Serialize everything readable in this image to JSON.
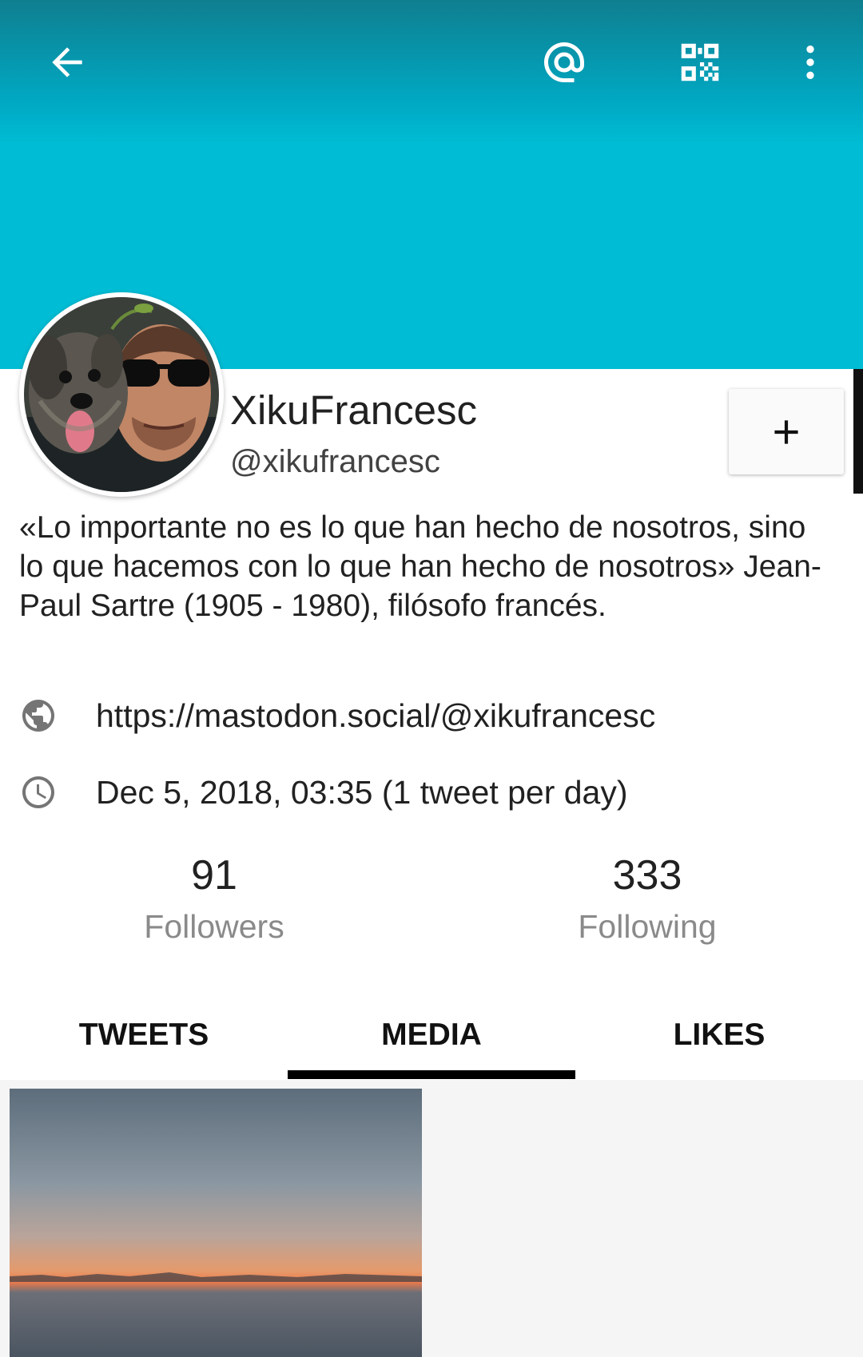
{
  "header": {
    "back_icon": "arrow-left-icon",
    "mention_icon": "at-sign-icon",
    "qr_icon": "qr-code-icon",
    "more_icon": "more-vertical-icon",
    "banner_color": "#00bcd4"
  },
  "profile": {
    "display_name": "XikuFrancesc",
    "handle": "@xikufrancesc",
    "bio": "«Lo importante no es lo que han hecho de nosotros, sino lo que hacemos con lo que han hecho de nosotros» Jean-Paul Sartre (1905 - 1980), filósofo francés.",
    "url": "https://mastodon.social/@xikufrancesc",
    "joined": "Dec 5, 2018, 03:35 (1 tweet per day)",
    "follow_icon": "plus-icon"
  },
  "stats": {
    "followers_count": "91",
    "followers_label": "Followers",
    "following_count": "333",
    "following_label": "Following"
  },
  "tabs": [
    {
      "label": "TWEETS",
      "selected": false
    },
    {
      "label": "MEDIA",
      "selected": true
    },
    {
      "label": "LIKES",
      "selected": false
    }
  ]
}
